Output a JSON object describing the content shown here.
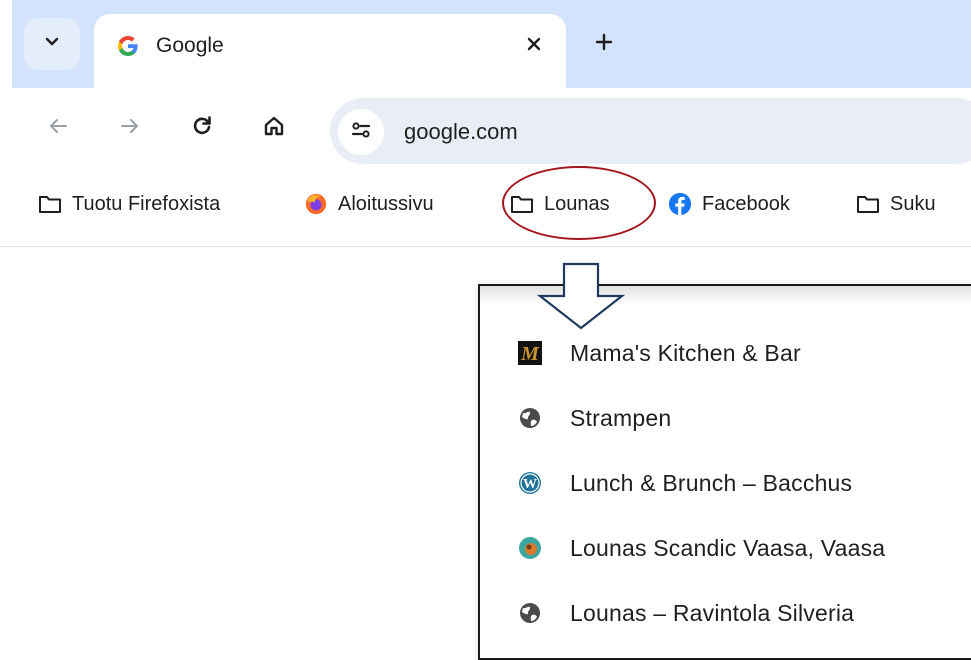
{
  "tab": {
    "title": "Google",
    "favicon_letter": "G",
    "close_glyph": "✕",
    "new_tab_glyph": "+"
  },
  "toolbar": {
    "url": "google.com",
    "icons": [
      "back-icon",
      "forward-icon",
      "reload-icon",
      "home-icon",
      "site-settings-icon"
    ]
  },
  "bookmarks": [
    {
      "label": "Tuotu Firefoxista",
      "icon": "folder-icon"
    },
    {
      "label": "Aloitussivu",
      "icon": "firefox-icon"
    },
    {
      "label": "Lounas",
      "icon": "folder-icon"
    },
    {
      "label": "Facebook",
      "icon": "facebook-icon"
    },
    {
      "label": "Suku",
      "icon": "folder-icon"
    }
  ],
  "dropdown": {
    "items": [
      {
        "label": "Mama's Kitchen & Bar",
        "icon": "mama-kitchen-icon",
        "icon_letter": "M"
      },
      {
        "label": "Strampen",
        "icon": "globe-icon"
      },
      {
        "label": "Lunch & Brunch – Bacchus",
        "icon": "wordpress-icon",
        "icon_letter": "W"
      },
      {
        "label": "Lounas Scandic Vaasa, Vaasa",
        "icon": "scandic-icon"
      },
      {
        "label": "Lounas – Ravintola Silveria",
        "icon": "globe-icon"
      }
    ]
  },
  "colors": {
    "tabstrip": "#d3e3fd",
    "omnibox": "#e9eef6",
    "highlight_ring": "#a4141c",
    "facebook": "#1877f2"
  }
}
